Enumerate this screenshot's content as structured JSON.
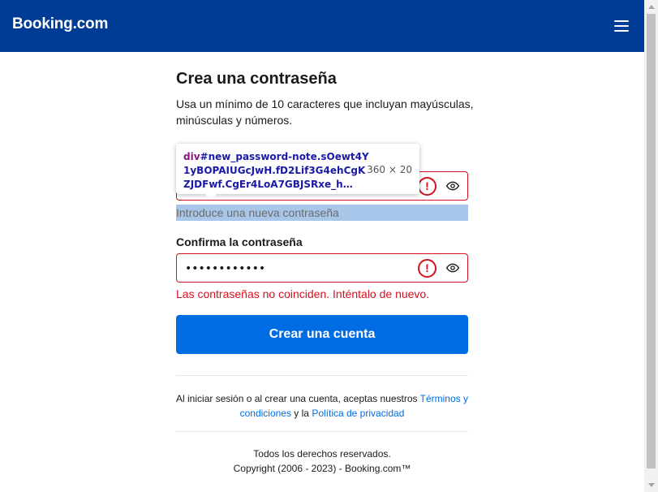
{
  "header": {
    "logo_text": "Booking.com",
    "menu_icon": "hamburger-icon",
    "bg_color": "#003b95"
  },
  "form": {
    "title": "Crea una contraseña",
    "subtitle": "Usa un mínimo de 10 caracteres que incluyan mayúsculas, minúsculas y números.",
    "password_helper": "Introduce una nueva contraseña",
    "confirm_label": "Confirma la contraseña",
    "confirm_value": "••••••••••••",
    "error_message": "Las contraseñas no coinciden. Inténtalo de nuevo.",
    "submit_label": "Crear una cuenta",
    "error_color": "#d4111e",
    "accent_color": "#006ce4"
  },
  "terms": {
    "prefix": "Al iniciar sesión o al crear una cuenta, aceptas nuestros ",
    "terms_link": "Términos y condiciones",
    "middle": " y la ",
    "privacy_link": "Política de privacidad"
  },
  "footer": {
    "line1": "Todos los derechos reservados.",
    "line2": "Copyright (2006 - 2023) - Booking.com™"
  },
  "devtools_tooltip": {
    "tag": "div",
    "selector": "#new_password-note.sOewt4Y1yBOPAIUGcJwH.fD2Lif3G4ehCgKZJDFwf.CgEr4LoA7GBJSRxe_h…",
    "size": "360 × 20"
  }
}
